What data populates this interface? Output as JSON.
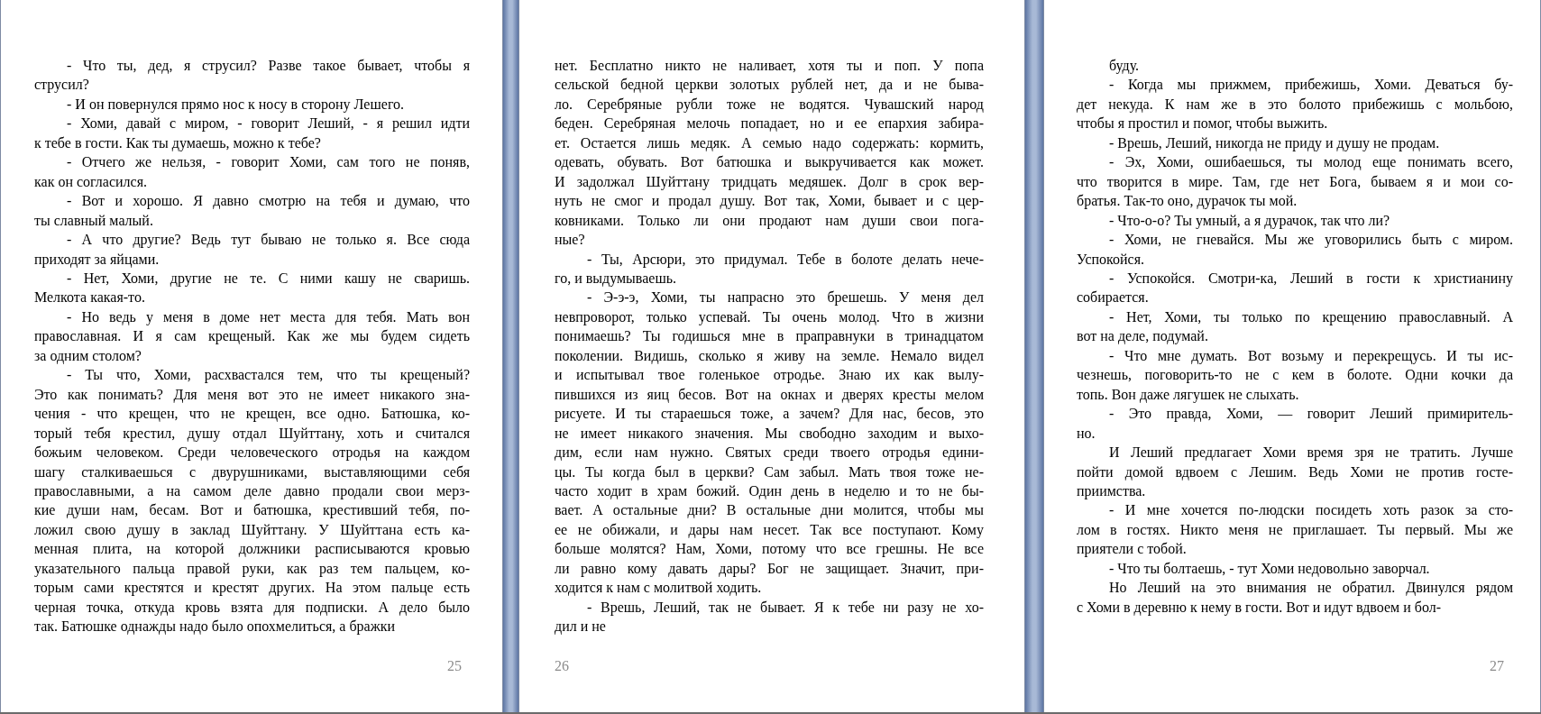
{
  "pages": [
    {
      "number": "25",
      "paragraphs": [
        {
          "kind": "paragraph",
          "lines": [
            "- Что ты, дед, я струсил? Разве такое бывает, чтобы я",
            "струсил?"
          ]
        },
        {
          "kind": "paragraph",
          "lines": [
            "- И он повернулся прямо нос к носу в сторону Лешего."
          ]
        },
        {
          "kind": "paragraph",
          "lines": [
            "- Хоми, давай с миром, - говорит Леший, - я решил идти",
            "к тебе в гости. Как ты думаешь, можно к тебе?"
          ]
        },
        {
          "kind": "paragraph",
          "lines": [
            "- Отчего же нельзя, - говорит Хоми, сам того не поняв,",
            "как он согласился."
          ]
        },
        {
          "kind": "paragraph",
          "lines": [
            "- Вот и хорошо. Я давно смотрю на тебя и думаю, что",
            "ты славный малый."
          ]
        },
        {
          "kind": "paragraph",
          "lines": [
            "- А что другие? Ведь тут бываю не только я. Все сюда",
            "приходят за яйцами."
          ]
        },
        {
          "kind": "paragraph",
          "lines": [
            "- Нет, Хоми, другие не те. С ними кашу не сваришь.",
            "Мелкота какая-то."
          ]
        },
        {
          "kind": "paragraph",
          "lines": [
            "- Но ведь у меня в доме нет места для тебя. Мать вон",
            "православная. И я сам крещеный. Как же мы будем сидеть",
            "за одним столом?"
          ]
        },
        {
          "kind": "paragraph",
          "lines": [
            "- Ты что, Хоми, расхвастался тем, что ты крещеный?",
            "Это как понимать? Для меня вот это не имеет никакого зна-",
            "чения - что крещен, что не крещен, все одно. Батюшка, ко-",
            "торый тебя крестил, душу отдал Шуйттану, хоть и считался",
            "божьим человеком. Среди человеческого отродья на каждом",
            "шагу сталкиваешься с двурушниками, выставляющими себя",
            "православными, а на самом деле давно продали свои мерз-",
            "кие души нам, бесам. Вот и батюшка, крестивший тебя, по-",
            "ложил свою душу в заклад Шуйттану. У Шуйттана есть ка-",
            "менная плита, на которой должники расписываются кровью",
            "указательного пальца правой руки, как раз тем пальцем, ко-",
            "торым сами крестятся и крестят других. На этом пальце есть",
            "черная точка, откуда кровь взята для подписки. А дело было",
            "так. Батюшке однажды надо было опохмелиться, а бражки"
          ]
        }
      ]
    },
    {
      "number": "26",
      "paragraphs": [
        {
          "kind": "continuation",
          "lines": [
            "нет. Бесплатно никто не наливает, хотя ты и поп. У попа",
            "сельской бедной церкви золотых рублей нет, да и не быва-",
            "ло. Серебряные рубли тоже не водятся. Чувашский народ",
            "беден. Серебряная мелочь попадает, но и ее епархия забира-",
            "ет. Остается лишь медяк. А семью надо содержать: кормить,",
            "одевать, обувать. Вот батюшка и выкручивается как может.",
            "И задолжал Шуйттану тридцать медяшек. Долг в срок вер-",
            "нуть не смог и продал душу. Вот так, Хоми, бывает и с цер-",
            "ковниками. Только ли они продают нам души свои пога-",
            "ные?"
          ]
        },
        {
          "kind": "paragraph",
          "lines": [
            "- Ты, Арсюри, это придумал. Тебе в болоте делать нече-",
            "го, и выдумываешь."
          ]
        },
        {
          "kind": "paragraph",
          "lines": [
            "- Э-э-э, Хоми, ты напрасно это брешешь. У меня дел",
            "невпроворот, только успевай. Ты очень молод. Что в жизни",
            "понимаешь? Ты годишься мне в праправнуки в тринадцатом",
            "поколении. Видишь, сколько я живу на земле. Немало видел",
            "и испытывал твое голенькое отродье. Знаю их как вылу-",
            "пившихся из яиц бесов. Вот на окнах и дверях кресты мелом",
            "рисуете. И ты стараешься тоже, а зачем? Для нас, бесов, это",
            "не имеет никакого значения. Мы свободно заходим и выхо-",
            "дим, если нам нужно. Святых среди твоего отродья едини-",
            "цы. Ты когда был в церкви? Сам забыл. Мать твоя тоже не-",
            "часто ходит в храм божий. Один день в неделю и то не бы-",
            "вает. А остальные дни? В остальные дни молится, чтобы мы",
            "ее не обижали, и дары нам несет. Так все поступают. Кому",
            "больше молятся? Нам, Хоми, потому что все грешны. Не все",
            "ли равно кому давать дары? Бог не защищает. Значит, при-",
            "ходится к нам с молитвой ходить."
          ]
        },
        {
          "kind": "paragraph",
          "lines": [
            "- Врешь, Леший, так не бывает. Я к тебе ни разу не хо-",
            "дил и не"
          ]
        }
      ]
    },
    {
      "number": "27",
      "paragraphs": [
        {
          "kind": "paragraph",
          "lines": [
            "буду."
          ]
        },
        {
          "kind": "paragraph",
          "lines": [
            "- Когда мы прижмем, прибежишь, Хоми. Деваться бу-",
            "дет некуда. К нам же в это болото прибежишь с мольбою,",
            "чтобы я простил и помог, чтобы выжить."
          ]
        },
        {
          "kind": "paragraph",
          "lines": [
            "- Врешь, Леший, никогда не приду и душу не продам."
          ]
        },
        {
          "kind": "paragraph",
          "lines": [
            "- Эх, Хоми, ошибаешься, ты молод еще понимать всего,",
            "что творится в мире. Там, где нет Бога, бываем я и мои со-",
            "братья. Так-то оно, дурачок ты мой."
          ]
        },
        {
          "kind": "paragraph",
          "lines": [
            "- Что-о-о? Ты умный, а я дурачок, так что ли?"
          ]
        },
        {
          "kind": "paragraph",
          "lines": [
            "- Хоми, не гневайся. Мы же уговорились быть с миром.",
            "Успокойся."
          ]
        },
        {
          "kind": "paragraph",
          "lines": [
            "- Успокойся. Смотри-ка, Леший в гости к христианину",
            "собирается."
          ]
        },
        {
          "kind": "paragraph",
          "lines": [
            "- Нет, Хоми, ты только по крещению православный. А",
            "вот на деле, подумай."
          ]
        },
        {
          "kind": "paragraph",
          "lines": [
            "- Что мне думать. Вот возьму и перекрещусь. И ты ис-",
            "чезнешь, поговорить-то не с кем в болоте. Одни кочки да",
            "топь. Вон даже лягушек не слыхать."
          ]
        },
        {
          "kind": "paragraph",
          "lines": [
            "- Это правда, Хоми, — говорит Леший примиритель-",
            "но."
          ]
        },
        {
          "kind": "paragraph",
          "lines": [
            "И Леший предлагает Хоми время зря не тратить. Лучше",
            "пойти домой вдвоем с Лешим. Ведь Хоми не против госте-",
            "приимства."
          ]
        },
        {
          "kind": "paragraph",
          "lines": [
            "- И мне хочется по-людски посидеть хоть разок за сто-",
            "лом в гостях. Никто меня не приглашает. Ты первый. Мы же",
            "приятели с тобой."
          ]
        },
        {
          "kind": "paragraph",
          "lines": [
            "- Что ты болтаешь, - тут Хоми недовольно заворчал."
          ]
        },
        {
          "kind": "paragraph",
          "lines": [
            "Но Леший на это внимания не обратил. Двинулся рядом",
            "с Хоми в деревню к нему в гости. Вот и идут вдвоем и бол-"
          ]
        }
      ]
    }
  ]
}
